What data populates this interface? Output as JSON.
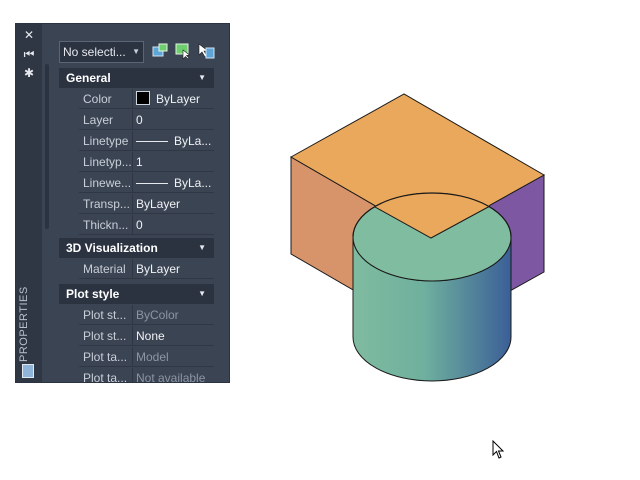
{
  "palette": {
    "title": "PROPERTIES",
    "selection": "No selecti...",
    "sections": [
      {
        "title": "General",
        "rows": [
          {
            "label": "Color",
            "value": "ByLayer",
            "swatch": "#000000"
          },
          {
            "label": "Layer",
            "value": "0"
          },
          {
            "label": "Linetype",
            "value": "ByLa..."
          },
          {
            "label": "Linetyp...",
            "value": "1"
          },
          {
            "label": "Linewe...",
            "value": "ByLa..."
          },
          {
            "label": "Transp...",
            "value": "ByLayer"
          },
          {
            "label": "Thickn...",
            "value": "0"
          }
        ]
      },
      {
        "title": "3D Visualization",
        "rows": [
          {
            "label": "Material",
            "value": "ByLayer"
          }
        ]
      },
      {
        "title": "Plot style",
        "rows": [
          {
            "label": "Plot st...",
            "value": "ByColor"
          },
          {
            "label": "Plot st...",
            "value": "None"
          },
          {
            "label": "Plot ta...",
            "value": "Model"
          },
          {
            "label": "Plot ta...",
            "value": "Not available"
          }
        ]
      }
    ]
  },
  "colors": {
    "box_top": "#eaa85c",
    "box_left": "#d7946a",
    "box_right": "#7e57a3",
    "cylinder_top": "#80bca0",
    "cylinder_side_left": "#7fbba0",
    "cylinder_side_right": "#3b5f97"
  }
}
